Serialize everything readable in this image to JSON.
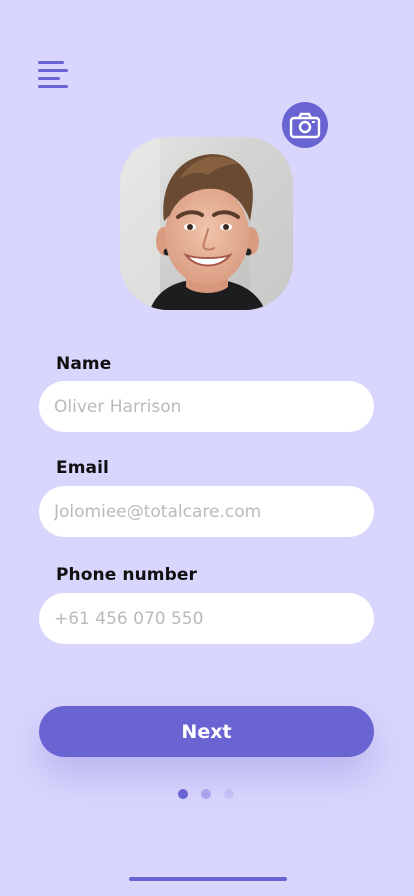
{
  "colors": {
    "background": "#d9d6fd",
    "accent": "#6a64d2",
    "input_background": "#ffffff",
    "placeholder_text": "#b9b9bf",
    "label_text": "#101010",
    "pager_active": "#6a64d2",
    "pager_inactive_1": "#a9a4ec",
    "pager_inactive_2": "#c4c0f4"
  },
  "header": {
    "menu_icon": "hamburger-menu-icon"
  },
  "profile": {
    "avatar": "profile-photo",
    "camera_icon": "camera-icon"
  },
  "form": {
    "name": {
      "label": "Name",
      "placeholder": "Oliver Harrison",
      "value": ""
    },
    "email": {
      "label": "Email",
      "placeholder": "Jolomiee@totalcare.com",
      "value": ""
    },
    "phone": {
      "label": "Phone number",
      "placeholder": "+61 456 070 550",
      "value": ""
    }
  },
  "actions": {
    "next_label": "Next"
  },
  "pager": {
    "total": 3,
    "active_index": 0
  }
}
